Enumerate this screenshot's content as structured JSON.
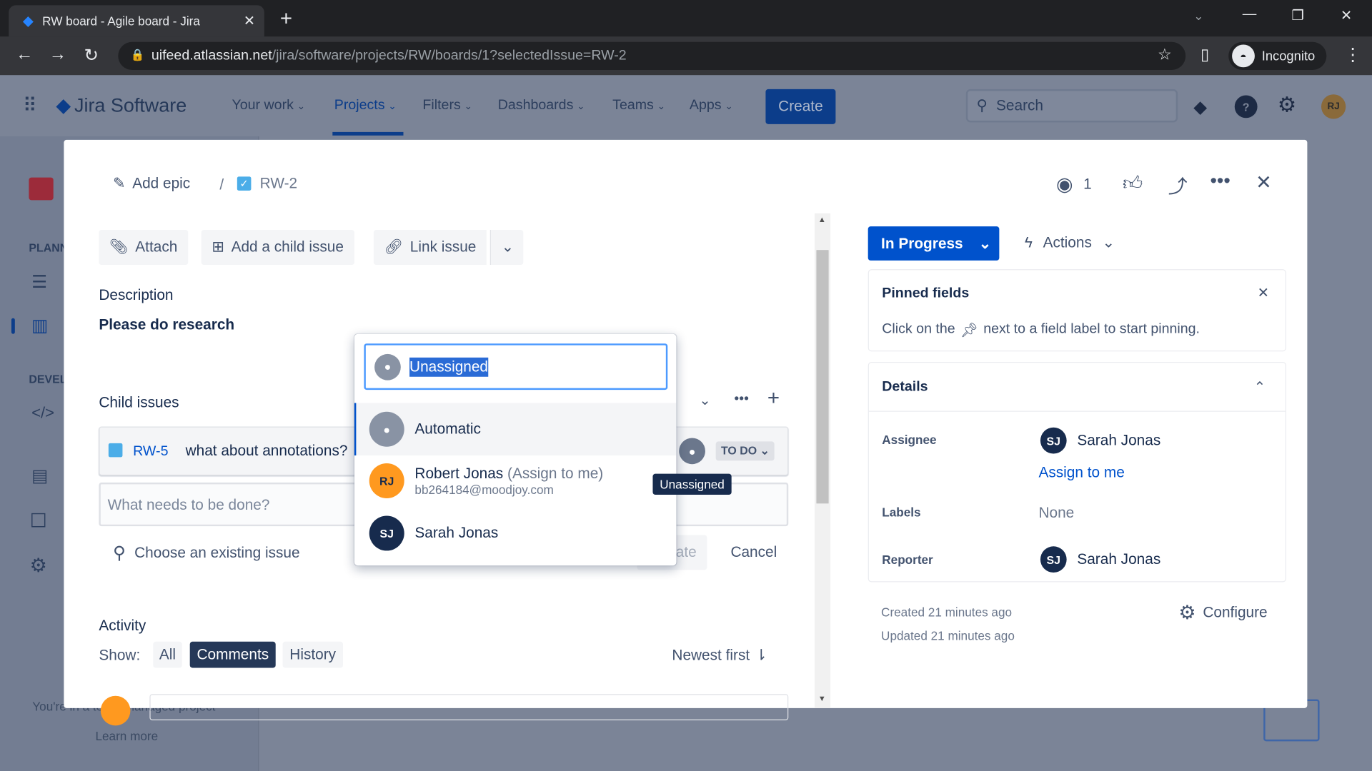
{
  "browser": {
    "tab_title": "RW board - Agile board - Jira",
    "url_host": "uifeed.atlassian.net",
    "url_path": "/jira/software/projects/RW/boards/1?selectedIssue=RW-2",
    "profile": "Incognito"
  },
  "nav": {
    "product": "Jira Software",
    "items": [
      "Your work",
      "Projects",
      "Filters",
      "Dashboards",
      "Teams",
      "Apps"
    ],
    "create": "Create",
    "search_placeholder": "Search",
    "avatar": "RJ"
  },
  "sidebar": {
    "planning": "PLANN",
    "development": "DEVEL",
    "footer": "You're in a team-managed project",
    "learn_more": "Learn more"
  },
  "issue": {
    "add_epic": "Add epic",
    "separator": "/",
    "key": "RW-2",
    "watchers": "1",
    "actions": {
      "attach": "Attach",
      "add_child": "Add a child issue",
      "link": "Link issue"
    },
    "description_label": "Description",
    "description": "Please do research",
    "child_issues_label": "Child issues",
    "child": {
      "key": "RW-5",
      "summary": "what about annotations?",
      "status": "TO DO"
    },
    "new_child_placeholder": "What needs to be done?",
    "choose_existing": "Choose an existing issue",
    "create_partial": "ate",
    "cancel": "Cancel",
    "activity_label": "Activity",
    "show_label": "Show:",
    "filters": [
      "All",
      "Comments",
      "History"
    ],
    "sort": "Newest first"
  },
  "assignee_picker": {
    "value": "Unassigned",
    "tooltip": "Unassigned",
    "options": [
      {
        "name": "Automatic",
        "suffix": "",
        "email": "",
        "initials": "",
        "color": "#8993a4"
      },
      {
        "name": "Robert Jonas",
        "suffix": "(Assign to me)",
        "email": "bb264184@moodjoy.com",
        "initials": "RJ",
        "color": "#ff991f"
      },
      {
        "name": "Sarah Jonas",
        "suffix": "",
        "email": "",
        "initials": "SJ",
        "color": "#172b4d"
      }
    ]
  },
  "panel": {
    "status": "In Progress",
    "status_color": "#0052cc",
    "actions": "Actions",
    "pinned_title": "Pinned fields",
    "pinned_text_before": "Click on the",
    "pinned_text_after": "next to a field label to start pinning.",
    "details_title": "Details",
    "assignee_label": "Assignee",
    "assignee": "Sarah Jonas",
    "assignee_initials": "SJ",
    "assign_to_me": "Assign to me",
    "labels_label": "Labels",
    "labels": "None",
    "reporter_label": "Reporter",
    "reporter": "Sarah Jonas",
    "reporter_initials": "SJ",
    "created": "Created 21 minutes ago",
    "updated": "Updated 21 minutes ago",
    "configure": "Configure"
  }
}
